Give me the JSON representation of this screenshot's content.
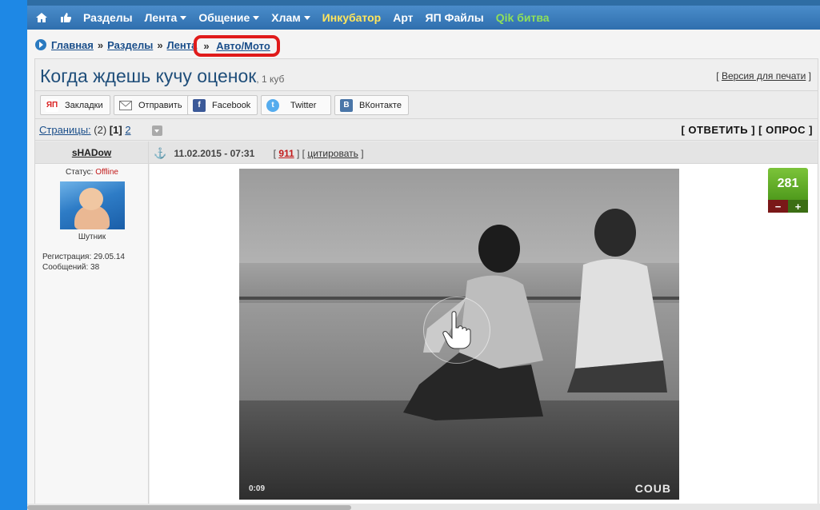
{
  "nav": {
    "items": [
      {
        "label": "Разделы",
        "style": "white",
        "caret": false
      },
      {
        "label": "Лента",
        "style": "white",
        "caret": true
      },
      {
        "label": "Общение",
        "style": "white",
        "caret": true
      },
      {
        "label": "Хлам",
        "style": "white",
        "caret": true
      },
      {
        "label": "Инкубатор",
        "style": "yellow",
        "caret": false
      },
      {
        "label": "Арт",
        "style": "white",
        "caret": false
      },
      {
        "label": "ЯП Файлы",
        "style": "white",
        "caret": false
      },
      {
        "label": "Qik битва",
        "style": "green",
        "caret": false
      }
    ],
    "icons": [
      "home-icon",
      "thumbs-up-icon"
    ]
  },
  "breadcrumb": {
    "items": [
      "Главная",
      "Разделы",
      "Лента",
      "Авто/Мото"
    ],
    "separator": "»"
  },
  "topic": {
    "title": "Когда ждешь кучу оценок",
    "subtitle": ", 1 куб",
    "print_version": "Версия для печати"
  },
  "share": [
    {
      "label": "Закладки",
      "icon": "yandex-icon",
      "color": "#d92020",
      "glyph": "ЯП"
    },
    {
      "label": "Отправить",
      "icon": "mail-icon",
      "color": "#ffffff",
      "glyph": "✉"
    },
    {
      "label": "Facebook",
      "icon": "facebook-icon",
      "color": "#3b5998",
      "glyph": "f"
    },
    {
      "label": "Twitter",
      "icon": "twitter-icon",
      "color": "#55acee",
      "glyph": "t"
    },
    {
      "label": "ВКонтакте",
      "icon": "vk-icon",
      "color": "#4a76a8",
      "glyph": "B"
    }
  ],
  "pages": {
    "label": "Страницы:",
    "count": "(2)",
    "current": "[1]",
    "next": "2"
  },
  "actions": {
    "reply": "ОТВЕТИТЬ",
    "poll": "ОПРОС"
  },
  "post": {
    "author": "sHADow",
    "date": "11.02.2015 - 07:31",
    "number": "911",
    "cite": "цитировать",
    "status_label": "Статус:",
    "status_value": "Offline",
    "rank": "Шутник",
    "reg_label": "Регистрация:",
    "reg_value": "29.05.14",
    "msg_label": "Сообщений:",
    "msg_value": "38",
    "rating": "281",
    "minus": "−",
    "plus": "+"
  },
  "video": {
    "time": "0:09",
    "brand": "COUB"
  }
}
